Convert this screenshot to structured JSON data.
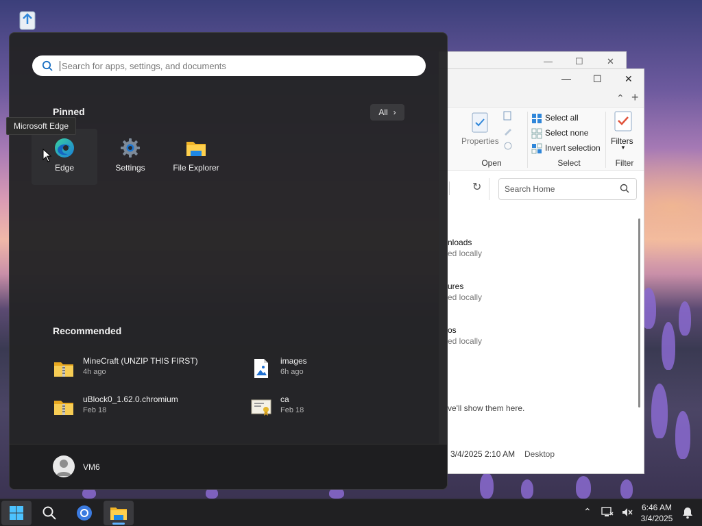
{
  "start_menu": {
    "search": {
      "placeholder": "Search for apps, settings, and documents"
    },
    "pinned": {
      "title": "Pinned",
      "all_button": "All",
      "items": [
        {
          "label": "Edge",
          "icon": "edge-icon"
        },
        {
          "label": "Settings",
          "icon": "gear-icon"
        },
        {
          "label": "File Explorer",
          "icon": "folder-icon"
        }
      ],
      "tooltip": "Microsoft Edge"
    },
    "recommended": {
      "title": "Recommended",
      "items": [
        {
          "name": "MineCraft (UNZIP THIS FIRST)",
          "time": "4h ago",
          "icon": "zip-folder-icon"
        },
        {
          "name": "images",
          "time": "6h ago",
          "icon": "image-file-icon"
        },
        {
          "name": "uBlock0_1.62.0.chromium",
          "time": "Feb 18",
          "icon": "zip-folder-icon"
        },
        {
          "name": "ca",
          "time": "Feb 18",
          "icon": "certificate-icon"
        }
      ]
    },
    "user": {
      "name": "VM6"
    }
  },
  "explorer": {
    "ribbon": {
      "properties_label": "Properties",
      "open_group": "Open",
      "select_all": "Select all",
      "select_none": "Select none",
      "invert_selection": "Invert selection",
      "select_group": "Select",
      "filters_label": "Filters",
      "filter_group": "Filter"
    },
    "search_placeholder": "Search Home",
    "items": [
      {
        "name": "nloads",
        "status": "ed locally"
      },
      {
        "name": "ures",
        "status": "ed locally"
      },
      {
        "name": "os",
        "status": "ed locally"
      }
    ],
    "empty_message": "ve'll show them here.",
    "recent_row": {
      "date": "3/4/2025 2:10 AM",
      "location": "Desktop"
    }
  },
  "taskbar": {
    "clock_time": "6:46 AM",
    "clock_date": "3/4/2025"
  },
  "colors": {
    "accent": "#5fb2ff",
    "start_bg": "#242426"
  }
}
